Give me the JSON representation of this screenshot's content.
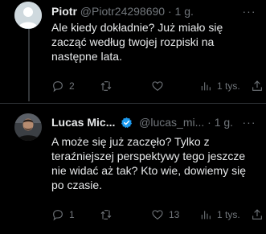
{
  "tweets": [
    {
      "author_name": "Piotr",
      "handle": "@Piotr24298690",
      "separator": "·",
      "time": "1 g.",
      "text": "Ale kiedy dokładnie? Już miało się zacząć według twojej rozpiski na następne lata.",
      "reply_count": "2",
      "retweet_count": "",
      "like_count": "",
      "views": "1 tys."
    },
    {
      "author_name": "Lucas Mic...",
      "handle": "@lucas_mi...",
      "separator": "·",
      "time": "1 g.",
      "text": "A może się już zaczęło? Tylko z teraźniejszej perspektywy tego jeszcze nie widać aż tak? Kto wie, dowiemy się po czasie.",
      "reply_count": "1",
      "retweet_count": "",
      "like_count": "13",
      "views": "1 tys."
    }
  ],
  "colors": {
    "background": "#000000",
    "text": "#e7e9ea",
    "muted": "#71767b",
    "verified": "#1d9bf0",
    "divider": "#2f3336"
  },
  "icons": {
    "reply": "reply-icon",
    "retweet": "retweet-icon",
    "like": "heart-icon",
    "views": "views-icon",
    "share": "share-icon",
    "more": "more-icon",
    "verified": "verified-badge-icon"
  }
}
